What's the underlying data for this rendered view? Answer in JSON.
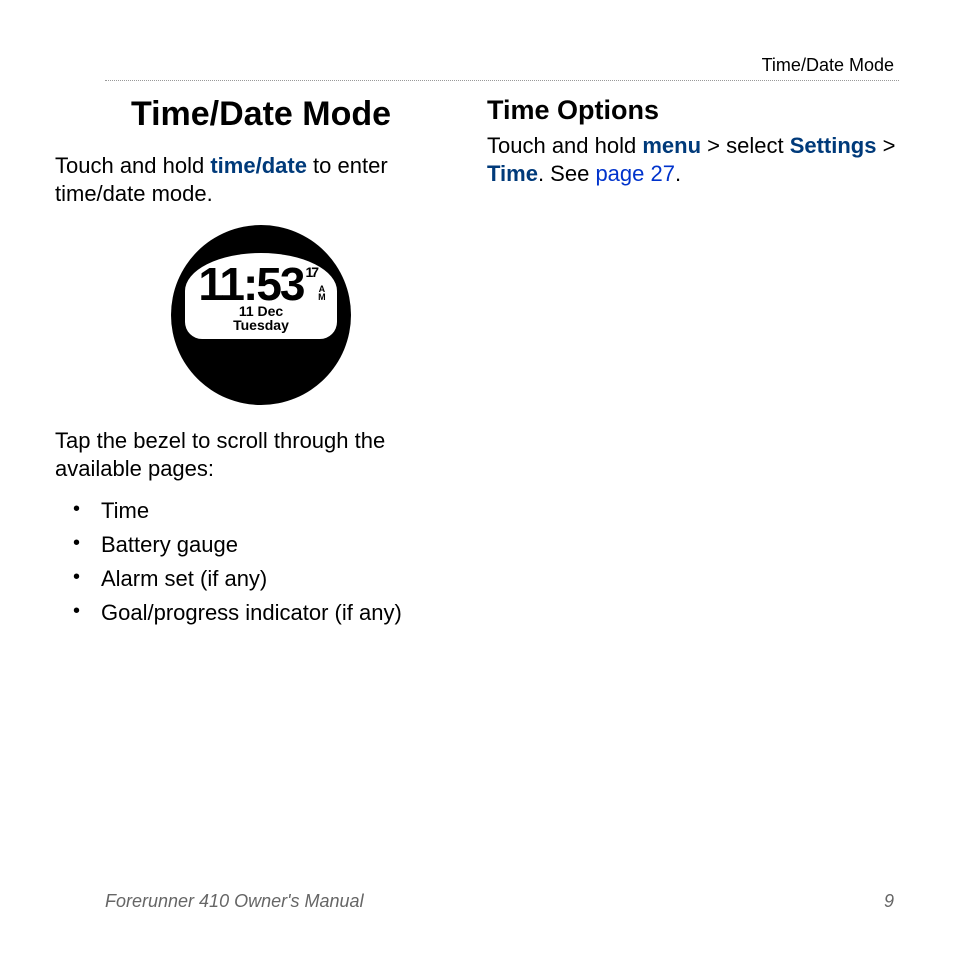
{
  "header": {
    "section_label": "Time/Date Mode"
  },
  "left": {
    "title": "Time/Date Mode",
    "intro_pre": "Touch and hold ",
    "intro_bold": "time/date",
    "intro_post": " to enter time/date mode.",
    "watch": {
      "time_main": "11:53",
      "seconds": "17",
      "ampm_a": "A",
      "ampm_m": "M",
      "date_line1": "11 Dec",
      "date_line2": "Tuesday"
    },
    "tap_text": "Tap the bezel to scroll through the available pages:",
    "bullets": [
      "Time",
      "Battery gauge",
      "Alarm set (if any)",
      "Goal/progress indicator (if any)"
    ]
  },
  "right": {
    "title": "Time Options",
    "p1_pre": "Touch and hold ",
    "p1_menu": "menu",
    "p1_mid1": " > select ",
    "p1_settings": "Settings",
    "p1_mid2": " > ",
    "p1_time": "Time",
    "p1_post1": ". See ",
    "p1_link": "page 27",
    "p1_post2": "."
  },
  "footer": {
    "manual": "Forerunner 410 Owner's Manual",
    "page": "9"
  }
}
